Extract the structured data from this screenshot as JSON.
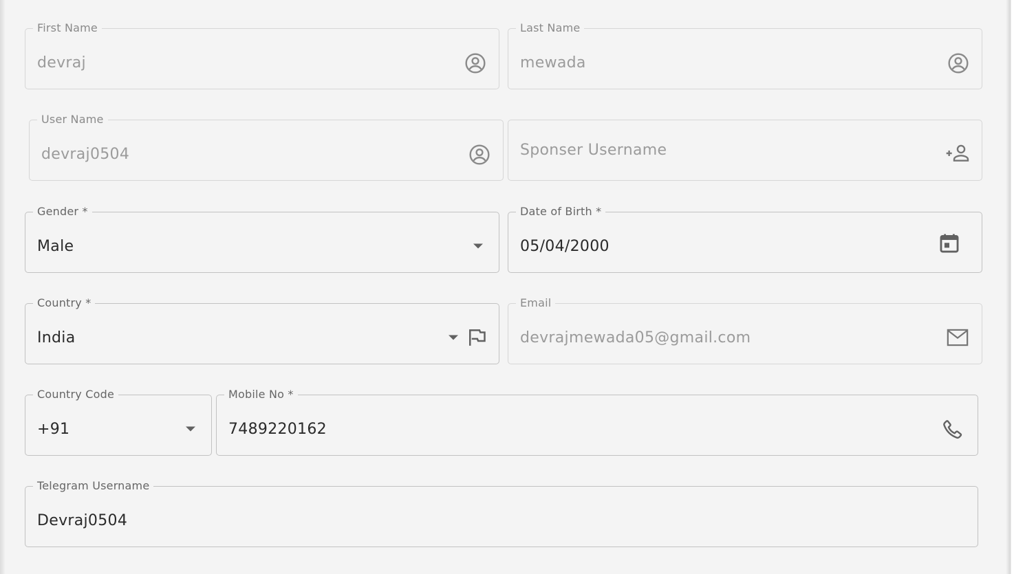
{
  "form": {
    "first_name": {
      "label": "First Name",
      "value": "devraj",
      "icon": "account-circle-icon"
    },
    "last_name": {
      "label": "Last Name",
      "value": "mewada",
      "icon": "account-circle-icon"
    },
    "user_name": {
      "label": "User Name",
      "value": "devraj0504",
      "icon": "account-circle-icon"
    },
    "sponsor_username": {
      "placeholder": "Sponser Username",
      "icon": "person-add-icon"
    },
    "gender": {
      "label": "Gender *",
      "value": "Male",
      "icon": "dropdown-arrow-icon"
    },
    "date_of_birth": {
      "label": "Date of Birth *",
      "value": "05/04/2000",
      "icon": "calendar-icon"
    },
    "country": {
      "label": "Country *",
      "value": "India",
      "icon": "flag-icon"
    },
    "email": {
      "label": "Email",
      "value": "devrajmewada05@gmail.com",
      "icon": "mail-icon"
    },
    "country_code": {
      "label": "Country Code",
      "value": "+91",
      "icon": "dropdown-arrow-icon"
    },
    "mobile_no": {
      "label": "Mobile No *",
      "value": "7489220162",
      "icon": "phone-icon"
    },
    "telegram_username": {
      "label": "Telegram Username",
      "value": "Devraj0504"
    }
  },
  "colors": {
    "background": "#f4f4f4",
    "border": "#d6d6d6",
    "label_text": "#8a8a8a",
    "disabled_text": "#9b9b9b",
    "active_text": "#2a2a2a",
    "icon": "#757575"
  }
}
